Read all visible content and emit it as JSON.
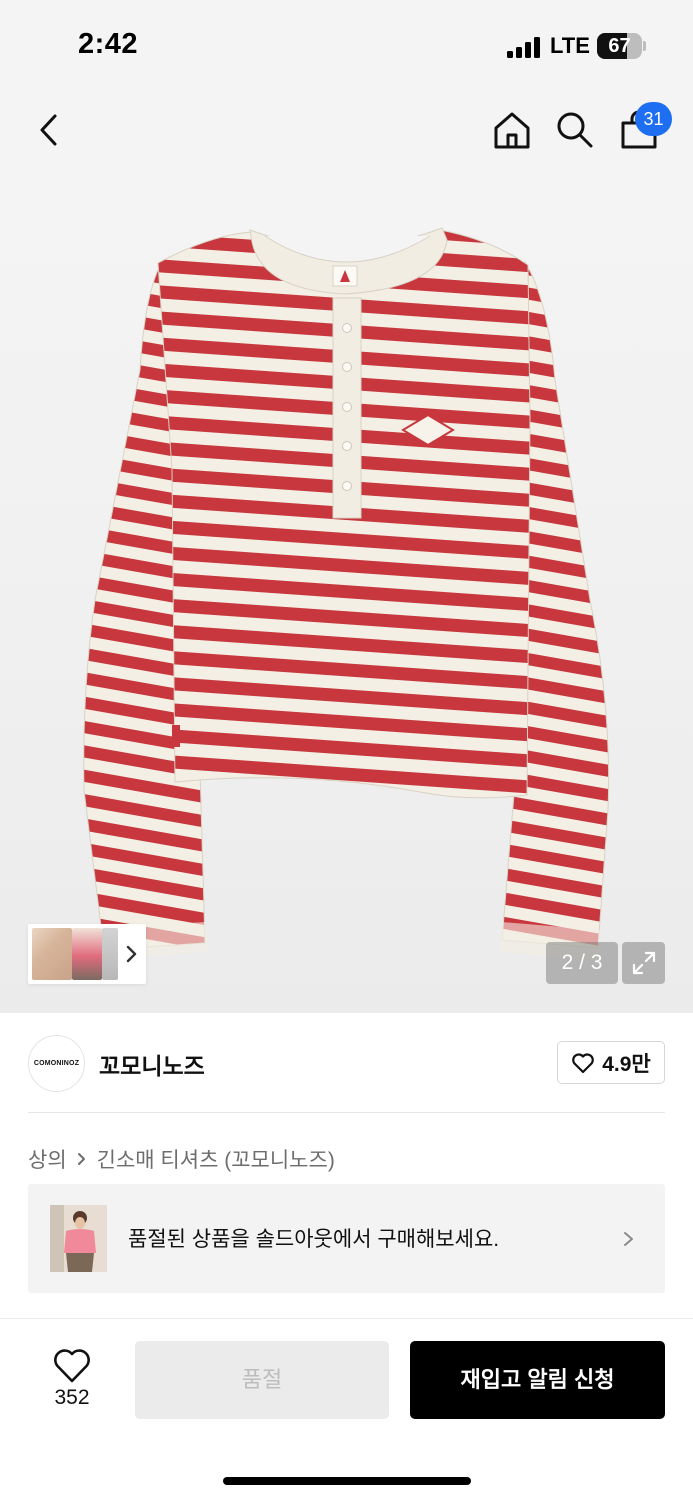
{
  "status_bar": {
    "time": "2:42",
    "network": "LTE",
    "battery_percent": "67",
    "battery_level": 0.67
  },
  "nav": {
    "icons": [
      "chevron-left-icon",
      "home-icon",
      "search-icon",
      "shopping-bag-icon"
    ],
    "cart_count": "31"
  },
  "gallery": {
    "counter": "2 / 3",
    "current_image": 2,
    "total_images": 3
  },
  "brand": {
    "logo_text": "COMONINOZ",
    "name": "꼬모니노즈",
    "like_count": "4.9만"
  },
  "breadcrumb": {
    "category": "상의",
    "subcategory": "긴소매 티셔츠 (꼬모니노즈)"
  },
  "soldout_banner": {
    "text": "품절된 상품을 솔드아웃에서 구매해보세요."
  },
  "bottom_bar": {
    "wish_count": "352",
    "soldout_label": "품절",
    "restock_label": "재입고 알림 신청"
  },
  "colors": {
    "accent_blue": "#1e6ef2",
    "stripe_red": "#c7373d",
    "stripe_cream": "#f3efe4",
    "primary_black": "#000000",
    "disabled_gray": "#ebebeb"
  }
}
